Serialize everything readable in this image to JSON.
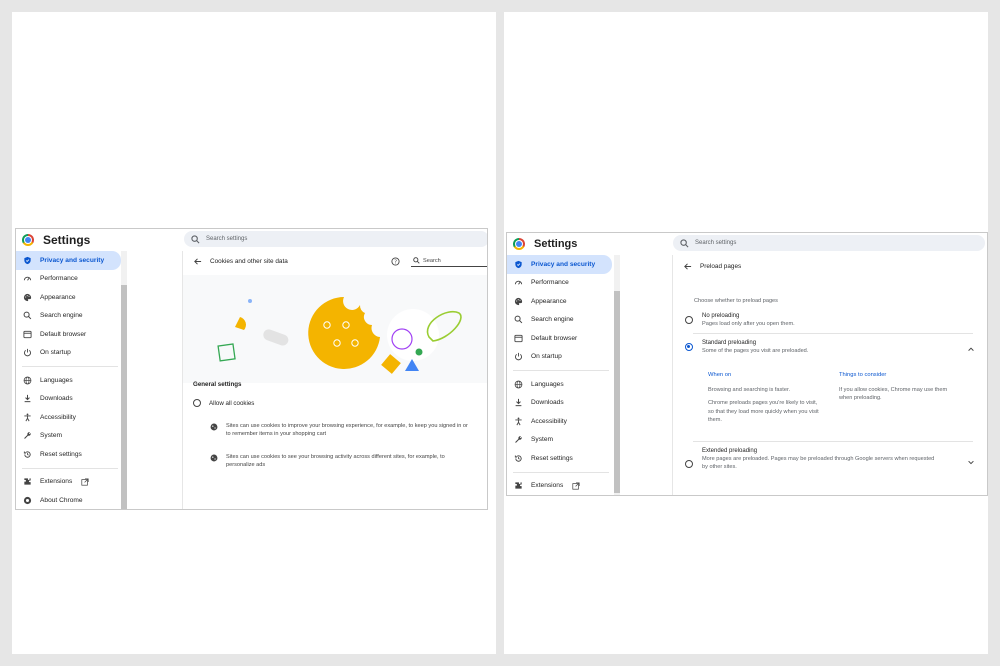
{
  "left": {
    "title": "Settings",
    "search_placeholder": "Search settings",
    "nav": [
      {
        "label": "Privacy and security",
        "icon": "shield-icon",
        "active": true
      },
      {
        "label": "Performance",
        "icon": "gauge-icon"
      },
      {
        "label": "Appearance",
        "icon": "palette-icon"
      },
      {
        "label": "Search engine",
        "icon": "search-icon"
      },
      {
        "label": "Default browser",
        "icon": "browser-window-icon"
      },
      {
        "label": "On startup",
        "icon": "power-icon"
      },
      {
        "label": "Languages",
        "icon": "globe-icon"
      },
      {
        "label": "Downloads",
        "icon": "download-icon"
      },
      {
        "label": "Accessibility",
        "icon": "accessibility-icon"
      },
      {
        "label": "System",
        "icon": "wrench-icon"
      },
      {
        "label": "Reset settings",
        "icon": "history-icon"
      },
      {
        "label": "Extensions",
        "icon": "puzzle-icon"
      },
      {
        "label": "About Chrome",
        "icon": "chrome-logo-icon"
      }
    ],
    "page_title": "Cookies and other site data",
    "inner_search_placeholder": "Search",
    "general_settings": "General settings",
    "allow_all": "Allow all cookies",
    "bullet1": "Sites can use cookies to improve your browsing experience, for example, to keep you signed in or",
    "bullet1b": "to remember items in your shopping cart",
    "bullet2": "Sites can use cookies to see your browsing activity across different sites, for example, to",
    "bullet2b": "personalize ads",
    "colors": {
      "accent": "#0b57d0",
      "cookie": "#f4b400",
      "green": "#34a853",
      "purple": "#a142f4",
      "blue": "#4285f4"
    }
  },
  "right": {
    "title": "Settings",
    "search_placeholder": "Search settings",
    "nav": [
      {
        "label": "Privacy and security",
        "icon": "shield-icon",
        "active": true
      },
      {
        "label": "Performance",
        "icon": "gauge-icon"
      },
      {
        "label": "Appearance",
        "icon": "palette-icon"
      },
      {
        "label": "Search engine",
        "icon": "search-icon"
      },
      {
        "label": "Default browser",
        "icon": "browser-window-icon"
      },
      {
        "label": "On startup",
        "icon": "power-icon"
      },
      {
        "label": "Languages",
        "icon": "globe-icon"
      },
      {
        "label": "Downloads",
        "icon": "download-icon"
      },
      {
        "label": "Accessibility",
        "icon": "accessibility-icon"
      },
      {
        "label": "System",
        "icon": "wrench-icon"
      },
      {
        "label": "Reset settings",
        "icon": "history-icon"
      },
      {
        "label": "Extensions",
        "icon": "puzzle-icon"
      }
    ],
    "page_title": "Preload pages",
    "choose": "Choose whether to preload pages",
    "no_preload_title": "No preloading",
    "no_preload_desc": "Pages load only after you open them.",
    "std_title": "Standard preloading",
    "std_desc": "Some of the pages you visit are preloaded.",
    "when_on": "When on",
    "things": "Things to consider",
    "when1": "Browsing and searching is faster.",
    "when2a": "Chrome preloads pages you're likely to visit,",
    "when2b": "so that they load more quickly when you visit",
    "when2c": "them.",
    "things1a": "If you allow cookies, Chrome may use them",
    "things1b": "when preloading.",
    "ext_title": "Extended preloading",
    "ext_desc_a": "More pages are preloaded. Pages may be preloaded through Google servers when requested",
    "ext_desc_b": "by other sites."
  }
}
